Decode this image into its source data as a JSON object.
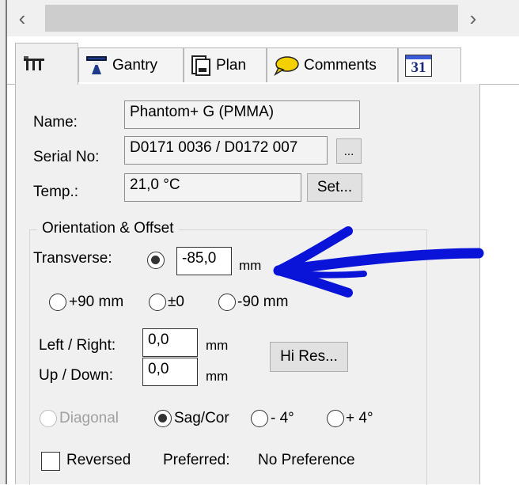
{
  "scrollbar": {
    "left_arrow": "‹",
    "right_arrow": "›"
  },
  "tabs": [
    {
      "id": "general",
      "label": "",
      "icon": "equipment-icon",
      "active": true
    },
    {
      "id": "gantry",
      "label": "Gantry",
      "icon": "gantry-icon"
    },
    {
      "id": "plan",
      "label": "Plan",
      "icon": "document-icon"
    },
    {
      "id": "comments",
      "label": "Comments",
      "icon": "speech-bubble-icon"
    },
    {
      "id": "calendar",
      "label": "",
      "icon": "calendar-icon",
      "icon_text": "31"
    }
  ],
  "form": {
    "name_label": "Name:",
    "name_value": "Phantom+ G (PMMA)",
    "serial_label": "Serial No:",
    "serial_value": "D0171 0036 / D0172 007",
    "serial_button": "...",
    "temp_label": "Temp.:",
    "temp_value": "21,0 °C",
    "temp_button": "Set..."
  },
  "orientation": {
    "title": "Orientation & Offset",
    "transverse_label": "Transverse:",
    "transverse_value": "-85,0",
    "transverse_unit": "mm",
    "presets": [
      "+90 mm",
      "±0",
      "-90 mm"
    ],
    "left_right_label": "Left / Right:",
    "left_right_value": "0,0",
    "left_right_unit": "mm",
    "up_down_label": "Up / Down:",
    "up_down_value": "0,0",
    "up_down_unit": "mm",
    "hires_button": "Hi Res...",
    "diagonal_label": "Diagonal",
    "sagcor_label": "Sag/Cor",
    "minus4_label": "- 4°",
    "plus4_label": "+ 4°",
    "reversed_label": "Reversed",
    "preferred_label": "Preferred:",
    "preferred_value": "No Preference"
  },
  "colors": {
    "annotation_arrow": "#0a14d8",
    "panel_bg": "#f0f0f0",
    "gantry_icon": "#1e3a8a",
    "comments_icon": "#f5d000"
  }
}
